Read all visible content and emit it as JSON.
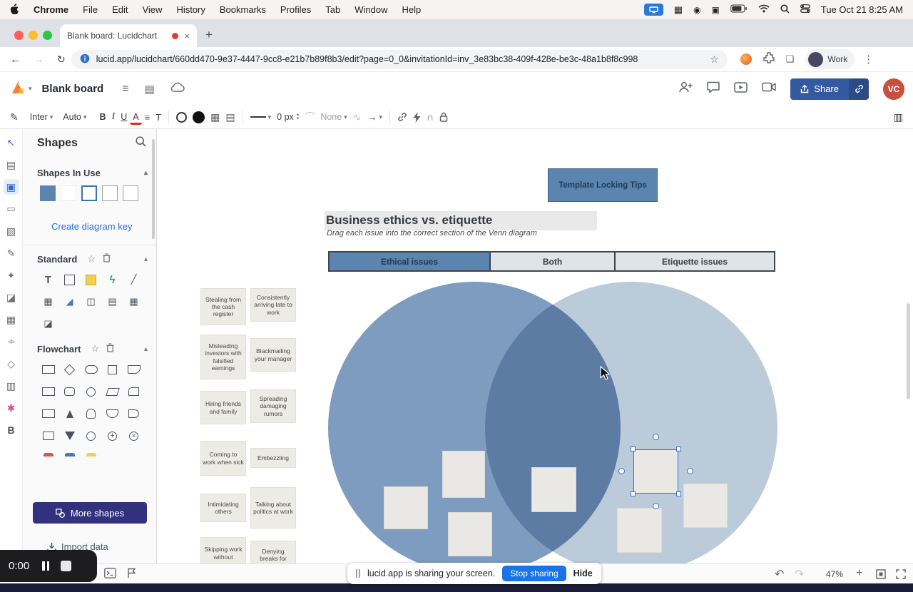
{
  "colors": {
    "accent_blue": "#1a73e8",
    "share_button": "#35599e",
    "venn_left": "#7e9cbf",
    "venn_right": "#bccbda",
    "venn_header_fill": "#5b84ae",
    "more_shapes_button": "#31317d",
    "avatar": "#c94f3d"
  },
  "icons": {
    "chevron_down": "▾",
    "chevron_up": "▴",
    "hamburger": "≡",
    "back_arrow": "←",
    "forward_arrow": "→",
    "reload": "↻",
    "star": "☆",
    "overflow_menu": "⋮",
    "close": "×",
    "undo": "↶",
    "redo": "↷",
    "plus": "+",
    "pen": "✎",
    "text_tool": "T",
    "align": "≡",
    "line": "—",
    "arrow": "→",
    "curve": "⌒",
    "squiggle": "∿",
    "magnet": "∩",
    "grid": "▦",
    "notes": "▤",
    "select_arrow": "↖",
    "diamond": "◇",
    "square": "▢",
    "sticky": "▣",
    "image": "▨",
    "spark": "✦",
    "chart": "◪",
    "layers": "▥",
    "apps": "✱",
    "code": "</>",
    "slash": "╱",
    "bolt": "ϟ",
    "play": "◢",
    "callout": "◫",
    "table": "▦",
    "letter_b": "B"
  },
  "menubar": {
    "app_name": "Chrome",
    "items": [
      "File",
      "Edit",
      "View",
      "History",
      "Bookmarks",
      "Profiles",
      "Tab",
      "Window",
      "Help"
    ],
    "clock": "Tue Oct 21 8:25 AM"
  },
  "browser": {
    "tab_title": "Blank board: Lucidchart",
    "url": "lucid.app/lucidchart/660dd470-9e37-4447-9cc8-e21b7b89f8b3/edit?page=0_0&invitationId=inv_3e83bc38-409f-428e-be3c-48a1b8f8c998",
    "profile_label": "Work"
  },
  "header": {
    "board_title": "Blank board",
    "share_label": "Share",
    "avatar_initials": "VC"
  },
  "toolbar": {
    "font_family": "Inter",
    "font_size": "Auto",
    "bold": "B",
    "italic": "I",
    "underline": "U",
    "text_color": "A",
    "stroke_width": "0 px",
    "arrow_style": "None"
  },
  "left_panel": {
    "title": "Shapes",
    "shapes_in_use": "Shapes In Use",
    "create_key": "Create diagram key",
    "standard": "Standard",
    "flowchart": "Flowchart",
    "more_shapes": "More shapes",
    "import_data": "Import data"
  },
  "recorder": {
    "time": "0:00"
  },
  "canvas": {
    "template_button": "Template Locking Tips",
    "title": "Business ethics vs. etiquette",
    "subtitle": "Drag each issue into the correct section of the Venn diagram",
    "venn_headers": [
      "Ethical issues",
      "Both",
      "Etiquette issues"
    ],
    "cards": [
      "Stealing from the cash register",
      "Consistently arriving late to work",
      "Misleading investors with falsified earnings",
      "Blackmailing your manager",
      "Hiring friends and family",
      "Spreading damaging rumors",
      "Coming to work when sick",
      "Embezzling",
      "Intimidating others",
      "Talking about politics at work",
      "Skipping work without",
      "Denying breaks for"
    ]
  },
  "share_banner": {
    "message": "lucid.app is sharing your screen.",
    "stop": "Stop sharing",
    "hide": "Hide"
  },
  "statusbar": {
    "zoom": "47%"
  }
}
